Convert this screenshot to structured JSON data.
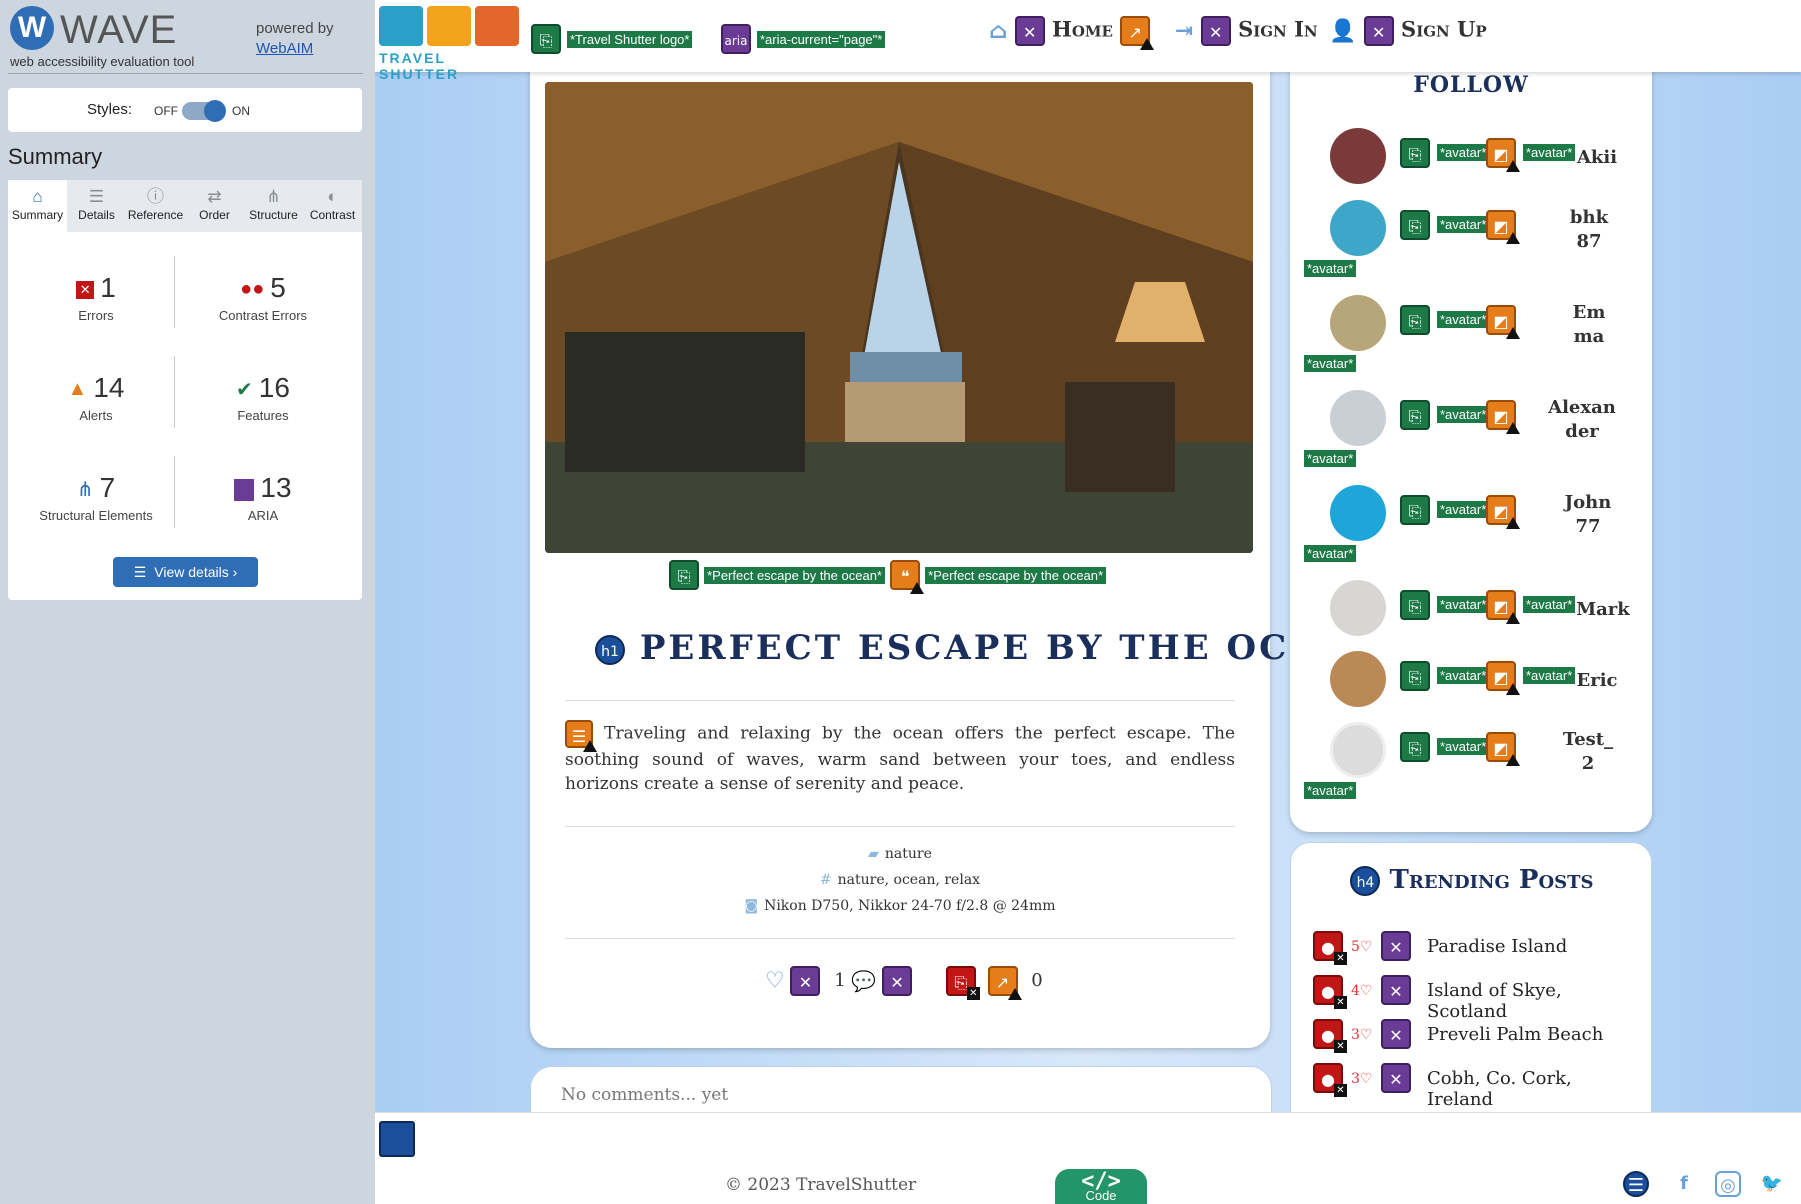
{
  "wave": {
    "title": "WAVE",
    "subtitle": "web accessibility evaluation tool",
    "powered_by": "powered by",
    "webaim": "WebAIM",
    "styles_label": "Styles:",
    "styles_off": "OFF",
    "styles_on": "ON",
    "summary_heading": "Summary",
    "tabs": [
      {
        "label": "Summary",
        "icon": "home-icon"
      },
      {
        "label": "Details",
        "icon": "list-icon"
      },
      {
        "label": "Reference",
        "icon": "info-icon"
      },
      {
        "label": "Order",
        "icon": "order-icon"
      },
      {
        "label": "Structure",
        "icon": "structure-icon"
      },
      {
        "label": "Contrast",
        "icon": "contrast-icon"
      }
    ],
    "stats": {
      "errors": {
        "value": "1",
        "label": "Errors"
      },
      "contrast": {
        "value": "5",
        "label": "Contrast Errors"
      },
      "alerts": {
        "value": "14",
        "label": "Alerts"
      },
      "features": {
        "value": "16",
        "label": "Features"
      },
      "structural": {
        "value": "7",
        "label": "Structural Elements"
      },
      "aria": {
        "value": "13",
        "label": "ARIA"
      }
    },
    "view_details": "View details ›"
  },
  "site": {
    "logo_text": "TRAVEL SHUTTER",
    "logo_alt_label": "*Travel Shutter logo*",
    "aria_badge": "aria",
    "aria_current_label": "*aria-current=\"page\"*",
    "nav": {
      "home": "Home",
      "sign_in": "Sign In",
      "sign_up": "Sign Up"
    },
    "post": {
      "img_label_1": "*Perfect escape by the ocean*",
      "img_label_2": "*Perfect escape by the ocean*",
      "h1_badge": "h1",
      "title": "PERFECT ESCAPE BY THE OCEAN",
      "body": "Traveling and relaxing by the ocean offers the perfect escape. The soothing sound of waves, warm sand between your toes, and endless horizons create a sense of serenity and peace.",
      "category": "nature",
      "tags": "nature, ocean, relax",
      "camera": "Nikon D750, Nikkor 24-70 f/2.8 @ 24mm",
      "likes": "1",
      "comments_count": "0"
    },
    "comments_placeholder": "No comments... yet",
    "follow_title": "FOLLOW",
    "avatar_label": "*avatar*",
    "followers": [
      {
        "name": "Akii"
      },
      {
        "name": "bhk87"
      },
      {
        "name": "Emma"
      },
      {
        "name": "Alexander"
      },
      {
        "name": "John77"
      },
      {
        "name": "Mark"
      },
      {
        "name": "Eric"
      },
      {
        "name": "Test_2"
      }
    ],
    "trending_badge": "h4",
    "trending_title": "Trending Posts",
    "trending": [
      {
        "likes": "5♡",
        "name": "Paradise Island"
      },
      {
        "likes": "4♡",
        "name": "Island of Skye, Scotland"
      },
      {
        "likes": "3♡",
        "name": "Preveli Palm Beach"
      },
      {
        "likes": "3♡",
        "name": "Cobh, Co. Cork, Ireland"
      },
      {
        "likes": "",
        "name": ""
      }
    ],
    "footer_copy": "© 2023 TravelShutter",
    "code_btn": "</>",
    "code_label": "Code"
  },
  "colors": {
    "wave_blue": "#2f6db5",
    "error_red": "#c21515",
    "alert_orange": "#e57d1b",
    "feature_green": "#1d7a47",
    "aria_purple": "#6a3c95",
    "title_navy": "#1b2f5c"
  }
}
